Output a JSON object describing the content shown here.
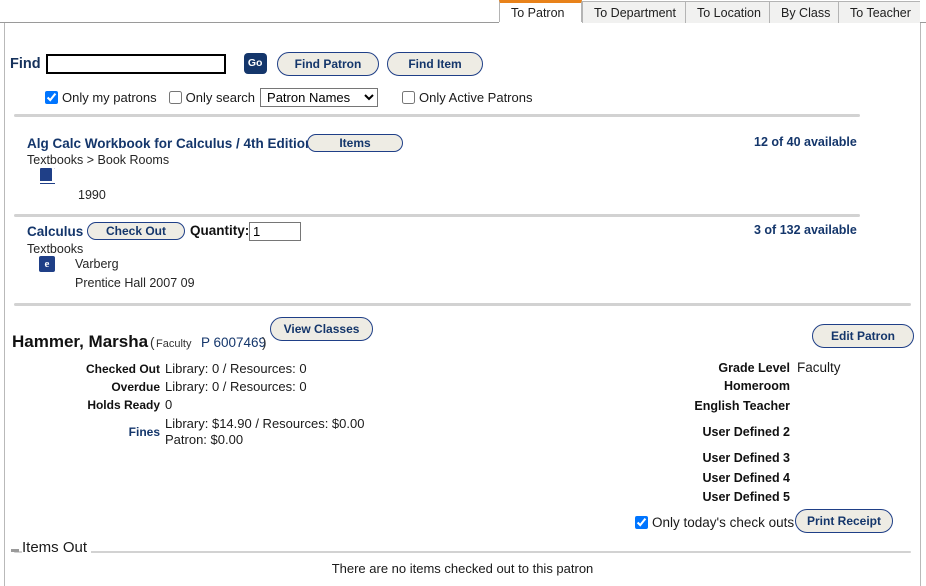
{
  "tabs": [
    {
      "label": "To Patron",
      "active": true
    },
    {
      "label": "To Department",
      "active": false
    },
    {
      "label": "To Location",
      "active": false
    },
    {
      "label": "By Class",
      "active": false
    },
    {
      "label": "To Teacher",
      "active": false
    }
  ],
  "search": {
    "find_label": "Find",
    "find_value": "",
    "find_placeholder": "",
    "go_label": "Go",
    "find_patron_label": "Find Patron",
    "find_item_label": "Find Item",
    "only_my_patrons_label": "Only my patrons",
    "only_my_patrons_checked": true,
    "only_search_label": "Only search",
    "only_search_checked": false,
    "scope_selected": "Patron Names",
    "scope_options": [
      "Patron Names"
    ],
    "only_active_patrons_label": "Only Active Patrons",
    "only_active_patrons_checked": false
  },
  "results": [
    {
      "title": "Alg Calc Workbook for Calculus / 4th Edition",
      "breadcrumb": "Textbooks > Book Rooms",
      "button_label": "Items",
      "availability": "12 of 40 available",
      "icon": "book-icon",
      "author": "",
      "imprint": "1990"
    },
    {
      "title": "Calculus",
      "breadcrumb": "Textbooks",
      "button_label": "Check Out",
      "quantity_label": "Quantity:",
      "quantity_value": "1",
      "availability": "3 of 132 available",
      "icon": "ebook-icon",
      "author": "Varberg",
      "imprint": "Prentice Hall  2007  09"
    }
  ],
  "patron": {
    "name": "Hammer, Marsha",
    "type": "Faculty",
    "id": "P 6007469",
    "view_classes_label": "View Classes",
    "edit_patron_label": "Edit Patron",
    "stats": [
      {
        "label": "Checked Out",
        "value": "Library: 0 / Resources: 0"
      },
      {
        "label": "Overdue",
        "value": "Library: 0 / Resources: 0"
      },
      {
        "label": "Holds Ready",
        "value": "0"
      }
    ],
    "fines_label": "Fines",
    "fines_line1": "Library: $14.90 / Resources: $0.00",
    "fines_line2": "Patron: $0.00",
    "fields": [
      {
        "label": "Grade Level",
        "value": "Faculty"
      },
      {
        "label": "Homeroom",
        "value": ""
      },
      {
        "label": "English Teacher",
        "value": ""
      },
      {
        "label": "User Defined 2",
        "value": ""
      },
      {
        "label": "User Defined 3",
        "value": ""
      },
      {
        "label": "User Defined 4",
        "value": ""
      },
      {
        "label": "User Defined 5",
        "value": ""
      }
    ],
    "only_today_label": "Only today's check outs",
    "only_today_checked": true,
    "print_receipt_label": "Print Receipt"
  },
  "items_out": {
    "heading": "Items Out",
    "empty_message": "There are no items checked out to this patron"
  }
}
